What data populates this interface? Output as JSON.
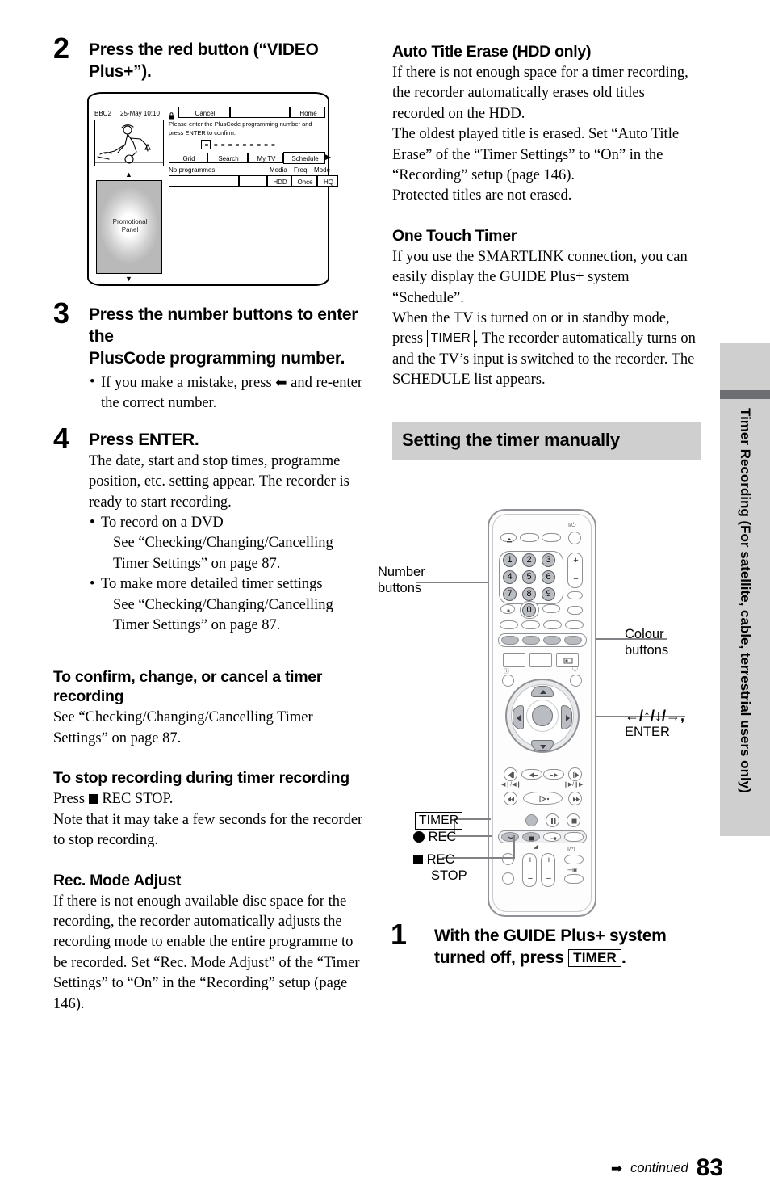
{
  "page": {
    "number": "83",
    "continued_label": "continued",
    "continued_arrow": "➡"
  },
  "side_tab": {
    "text": "Timer Recording (For satellite, cable, terrestrial users only)"
  },
  "left_column": {
    "step2": {
      "num": "2",
      "head": "Press the red button (“VIDEO Plus+”)."
    },
    "tv_screen": {
      "channel": "BBC2",
      "datetime": "25-May 10:10",
      "lock_icon": "lock-icon",
      "cancel": "Cancel",
      "home": "Home",
      "instruction_line1": "Please enter the PlusCode programming number and",
      "instruction_line2": "press ENTER to confirm.",
      "code_mask": "= = = = = = = = =",
      "tabs": [
        "Grid",
        "Search",
        "My TV",
        "Schedule"
      ],
      "selected_tab": "Schedule",
      "arrow_right": "▶",
      "no_programmes": "No programmes",
      "col_media": "Media",
      "col_freq": "Freq",
      "col_mode": "Mode",
      "val_media": "HDD",
      "val_freq": "Once",
      "val_mode": "HQ",
      "promo_panel_line1": "Promotional",
      "promo_panel_line2": "Panel",
      "up_arrow": "▲",
      "down_arrow": "▼"
    },
    "step3": {
      "num": "3",
      "head_line1": "Press the number buttons to enter the",
      "head_line2": "PlusCode programming number.",
      "bullet_pre": "If you make a mistake, press ",
      "bullet_arrow": "⬅",
      "bullet_post": " and re-enter the correct number."
    },
    "step4": {
      "num": "4",
      "head": "Press ENTER.",
      "body": "The date, start and stop times, programme position, etc. setting appear. The recorder is ready to start recording.",
      "bullets": [
        {
          "title": "To record on a DVD",
          "detail": "See “Checking/Changing/Cancelling Timer Settings” on page 87."
        },
        {
          "title": "To make more detailed timer settings",
          "detail": "See “Checking/Changing/Cancelling Timer Settings” on page 87."
        }
      ]
    },
    "confirm_section": {
      "heading": "To confirm, change, or cancel a timer recording",
      "body": "See “Checking/Changing/Cancelling Timer Settings” on page 87."
    },
    "stop_section": {
      "heading": "To stop recording during timer recording",
      "press_label": "Press",
      "rec_stop_label": "REC STOP.",
      "body": "Note that it may take a few seconds for the recorder to stop recording."
    },
    "rec_mode_section": {
      "heading": "Rec. Mode Adjust",
      "body": "If there is not enough available disc space for the recording, the recorder automatically adjusts the recording mode to enable the entire programme to be recorded. Set “Rec. Mode Adjust” of the “Timer Settings” to “On” in the “Recording” setup (page 146)."
    }
  },
  "right_column": {
    "auto_title_erase": {
      "heading": "Auto Title Erase (HDD only)",
      "para1": "If there is not enough space for a timer recording, the recorder automatically erases old titles recorded on the HDD.",
      "para2": "The oldest played title is erased. Set “Auto Title Erase” of the “Timer Settings” to “On” in the “Recording” setup (page 146).",
      "para3": "Protected titles are not erased."
    },
    "one_touch_timer": {
      "heading": "One Touch Timer",
      "para1": "If you use the SMARTLINK connection, you can easily display the GUIDE Plus+ system “Schedule”.",
      "para2_pre": "When the TV is turned on or in standby mode, press ",
      "key": "TIMER",
      "para2_post": ". The recorder automatically turns on and the TV’s input is switched to the recorder. The SCHEDULE list appears."
    },
    "section_heading": "Setting the timer manually",
    "remote_labels": {
      "number_buttons_l1": "Number",
      "number_buttons_l2": "buttons",
      "colour_buttons_l1": "Colour",
      "colour_buttons_l2": "buttons",
      "dpad_l1": "←/↑/↓/→,",
      "dpad_l2": "ENTER",
      "timer_key": "TIMER",
      "rec_label": "REC",
      "rec_stop_l1": "REC",
      "rec_stop_l2": "STOP"
    },
    "remote_keys": {
      "numbers": [
        "1",
        "2",
        "3",
        "4",
        "5",
        "6",
        "7",
        "8",
        "9",
        "0"
      ],
      "power": "I/⏻",
      "plus": "+",
      "minus": "−"
    },
    "step1": {
      "num": "1",
      "head_pre": "With the GUIDE Plus+ system turned off, press ",
      "key": "TIMER",
      "head_post": "."
    }
  }
}
